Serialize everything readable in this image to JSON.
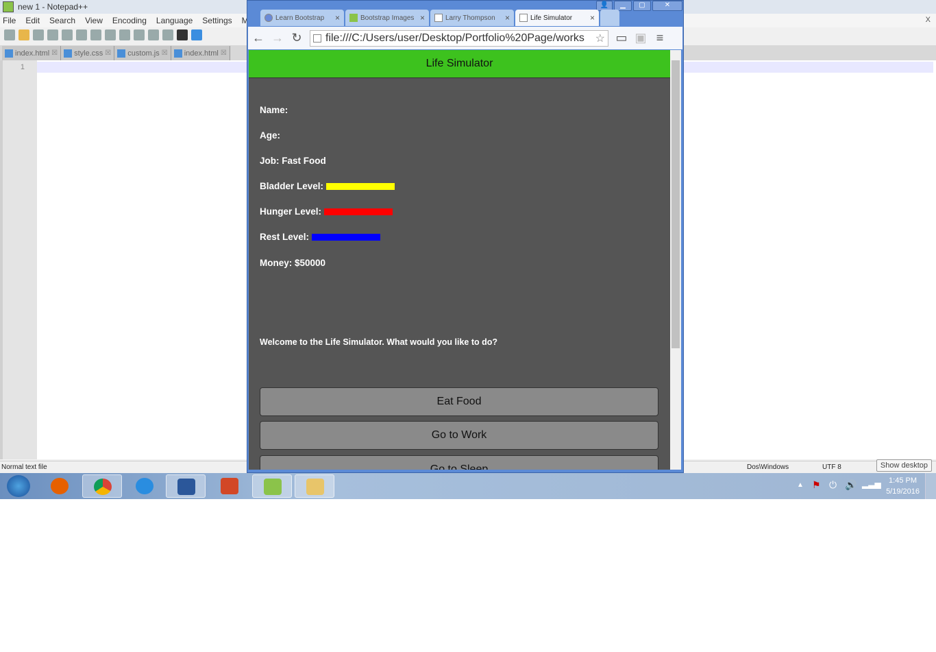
{
  "notepad": {
    "title": "new 1 - Notepad++",
    "menu": [
      "File",
      "Edit",
      "Search",
      "View",
      "Encoding",
      "Language",
      "Settings",
      "M"
    ],
    "tabs": [
      "index.html",
      "style.css",
      "custom.js",
      "index.html"
    ],
    "line_number": "1",
    "status": {
      "file_type": "Normal text file",
      "eol": "Dos\\Windows",
      "encoding": "UTF 8"
    },
    "close": "X"
  },
  "chrome": {
    "tabs": [
      "Learn Bootstrap",
      "Bootstrap Images",
      "Larry Thompson",
      "Life Simulator"
    ],
    "url": "file:///C:/Users/user/Desktop/Portfolio%20Page/works"
  },
  "app": {
    "title": "Life Simulator",
    "name_label": "Name:",
    "age_label": "Age:",
    "job": "Job: Fast Food",
    "bladder_label": "Bladder Level:",
    "hunger_label": "Hunger Level:",
    "rest_label": "Rest Level:",
    "money": "Money: $50000",
    "welcome": "Welcome to the Life Simulator. What would you like to do?",
    "buttons": [
      "Eat Food",
      "Go to Work",
      "Go to Sleep"
    ],
    "levels": {
      "bladder": {
        "percent": 100,
        "color": "#ffff00"
      },
      "hunger": {
        "percent": 100,
        "color": "#ff0000"
      },
      "rest": {
        "percent": 100,
        "color": "#0000ff"
      }
    },
    "header_color": "#3dc21e"
  },
  "taskbar": {
    "show_desktop": "Show desktop",
    "time": "1:45 PM",
    "date": "5/19/2016"
  }
}
